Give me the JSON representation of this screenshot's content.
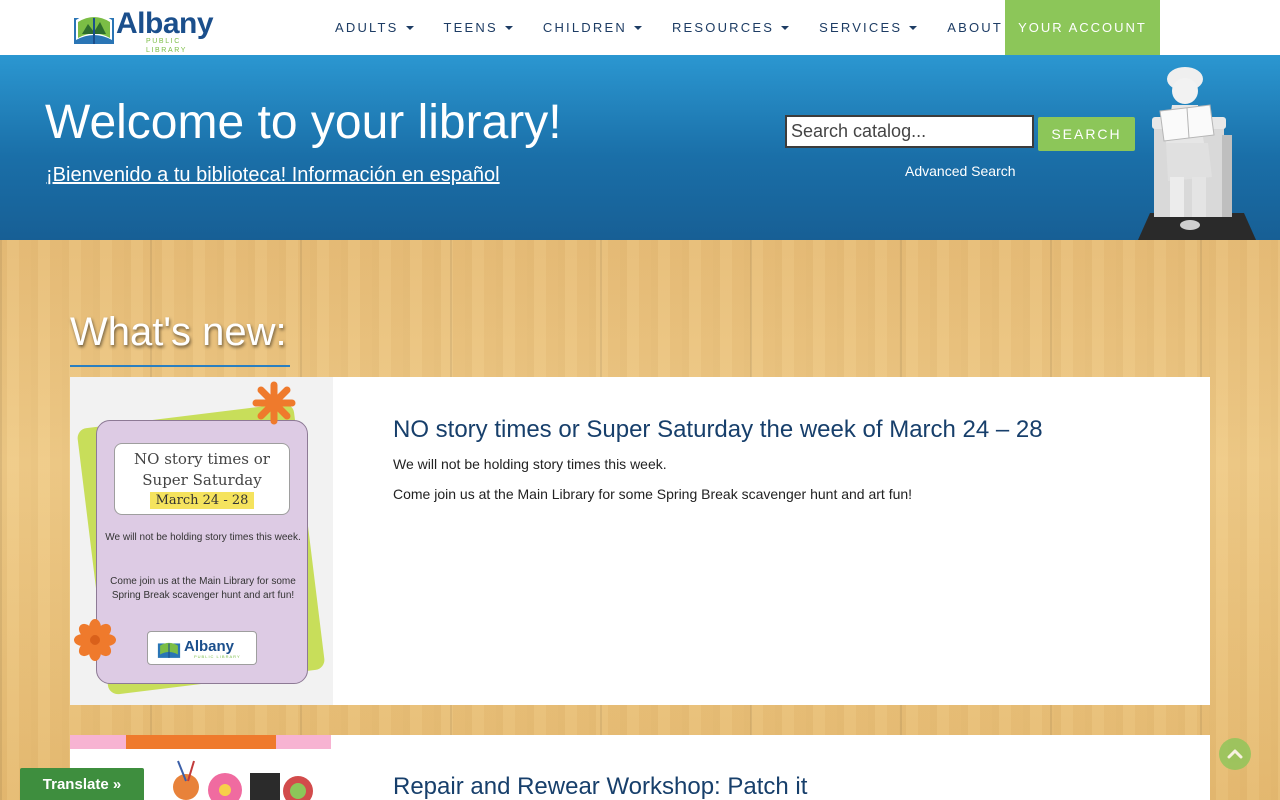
{
  "header": {
    "logo_text": "Albany",
    "logo_subtext": "PUBLIC LIBRARY",
    "nav": [
      {
        "label": "ADULTS"
      },
      {
        "label": "TEENS"
      },
      {
        "label": "CHILDREN"
      },
      {
        "label": "RESOURCES"
      },
      {
        "label": "SERVICES"
      },
      {
        "label": "ABOUT"
      }
    ],
    "account_label": "YOUR ACCOUNT"
  },
  "hero": {
    "title": "Welcome to your library!",
    "spanish_link": "¡Bienvenido a tu biblioteca! Información en español",
    "search": {
      "placeholder": "Search catalog...",
      "value": "",
      "button_label": "SEARCH",
      "advanced_label": "Advanced Search"
    }
  },
  "news": {
    "heading": "What's new:",
    "items": [
      {
        "title": "NO story times or Super Saturday the week of March 24 – 28",
        "paragraphs": [
          "We will not be holding story times this week.",
          "Come join us at the Main Library for some Spring Break scavenger hunt and art fun!"
        ],
        "flyer": {
          "line1": "NO story times or",
          "line2": "Super Saturday",
          "dates": "March 24 - 28",
          "p1": "We will not be holding story times this week.",
          "p2": "Come join us at the Main Library for some Spring Break scavenger hunt and art fun!",
          "logo_text": "Albany",
          "logo_subtext": "PUBLIC LIBRARY"
        }
      },
      {
        "title": "Repair and Rewear Workshop: Patch it"
      }
    ]
  },
  "widgets": {
    "translate_label": "Translate »"
  },
  "colors": {
    "brand_blue": "#1b4f8c",
    "brand_green": "#8cc659",
    "hero_blue": "#1a6fa8",
    "title_navy": "#173f6b"
  },
  "icons": {
    "caret": "caret-down-icon",
    "to_top": "chevron-up-icon",
    "logo": "library-book-logo-icon"
  }
}
